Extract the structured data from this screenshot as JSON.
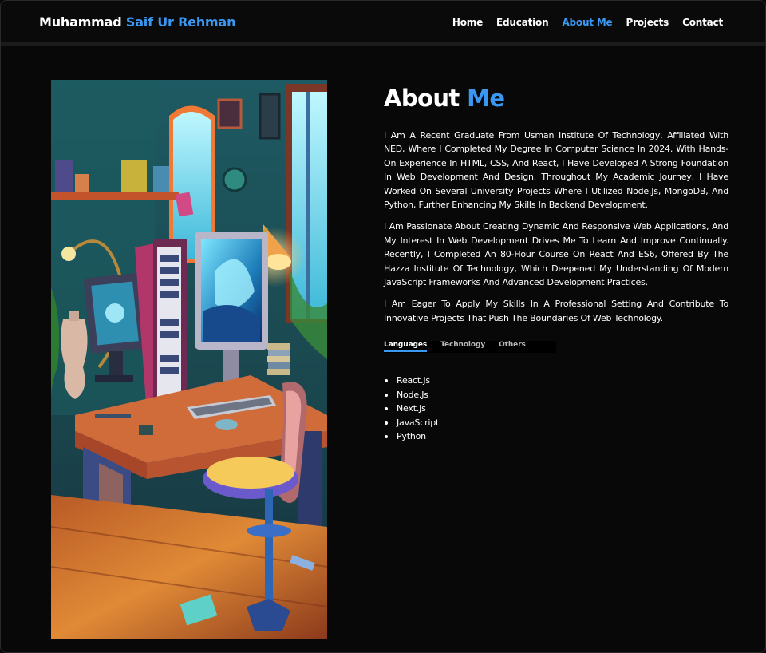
{
  "header": {
    "brand_first": "Muhammad",
    "brand_highlight": "Saif Ur Rehman",
    "nav": [
      {
        "label": "Home",
        "active": false
      },
      {
        "label": "Education",
        "active": false
      },
      {
        "label": "About Me",
        "active": true
      },
      {
        "label": "Projects",
        "active": false
      },
      {
        "label": "Contact",
        "active": false
      }
    ]
  },
  "about": {
    "title_plain": "About",
    "title_highlight": "Me",
    "paragraphs": [
      "I Am A Recent Graduate From Usman Institute Of Technology, Affiliated With NED, Where I Completed My Degree In Computer Science In 2024. With Hands-On Experience In HTML, CSS, And React, I Have Developed A Strong Foundation In Web Development And Design. Throughout My Academic Journey, I Have Worked On Several University Projects Where I Utilized Node.Js, MongoDB, And Python, Further Enhancing My Skills In Backend Development.",
      "I Am Passionate About Creating Dynamic And Responsive Web Applications, And My Interest In Web Development Drives Me To Learn And Improve Continually. Recently, I Completed An 80-Hour Course On React And ES6, Offered By The Hazza Institute Of Technology, Which Deepened My Understanding Of Modern JavaScript Frameworks And Advanced Development Practices.",
      "I Am Eager To Apply My Skills In A Professional Setting And Contribute To Innovative Projects That Push The Boundaries Of Web Technology."
    ],
    "tabs": [
      {
        "label": "Languages",
        "active": true
      },
      {
        "label": "Technology",
        "active": false
      },
      {
        "label": "Others",
        "active": false
      }
    ],
    "skills": [
      "React.Js",
      "Node.Js",
      "Next.Js",
      "JavaScript",
      "Python"
    ]
  },
  "colors": {
    "accent": "#3a98f2",
    "background": "#080808",
    "text": "#ffffff"
  }
}
